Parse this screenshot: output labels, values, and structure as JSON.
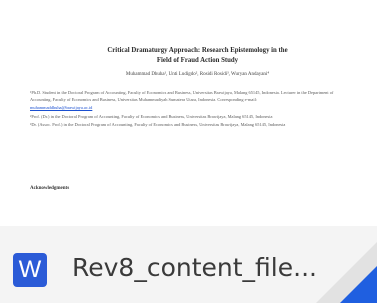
{
  "document_preview": {
    "title_line1": "Critical Dramaturgy Approach: Research Epistemology in the",
    "title_line2": "Field of Fraud Action Study",
    "authors": "Muhammad Dhuha¹, Unti Ludigdo², Rosidi Rosidi³, Wuryan Andayani⁴",
    "notes": [
      "¹Ph.D. Student in the Doctoral Program of Accounting, Faculty of Economics and Business, Universitas Brawijaya, Malang 65145, Indonesia. Lecturer in the Department of Accounting, Faculty of Economics and Business, Universitas Muhammadiyah Sumatera Utara, Indonesia. Corresponding e-mail:",
      "muhammaddhuha@brawijaya.ac.id",
      "²Prof. (Dr.) in the Doctoral Program of Accounting, Faculty of Economics and Business, Universitas Brawijaya, Malang 65145, Indonesia",
      "³Dr. (Assoc. Prof.) in the Doctoral Program of Accounting, Faculty of Economics and Business, Universitas Brawijaya, Malang 65145, Indonesia"
    ],
    "ack": "Acknowledgments"
  },
  "file": {
    "app_icon_letter": "W",
    "app_icon": "word-icon",
    "name": "Rev8_content_file...",
    "accent_color": "#2b5bd7",
    "corner_color": "#1f5fe0"
  }
}
